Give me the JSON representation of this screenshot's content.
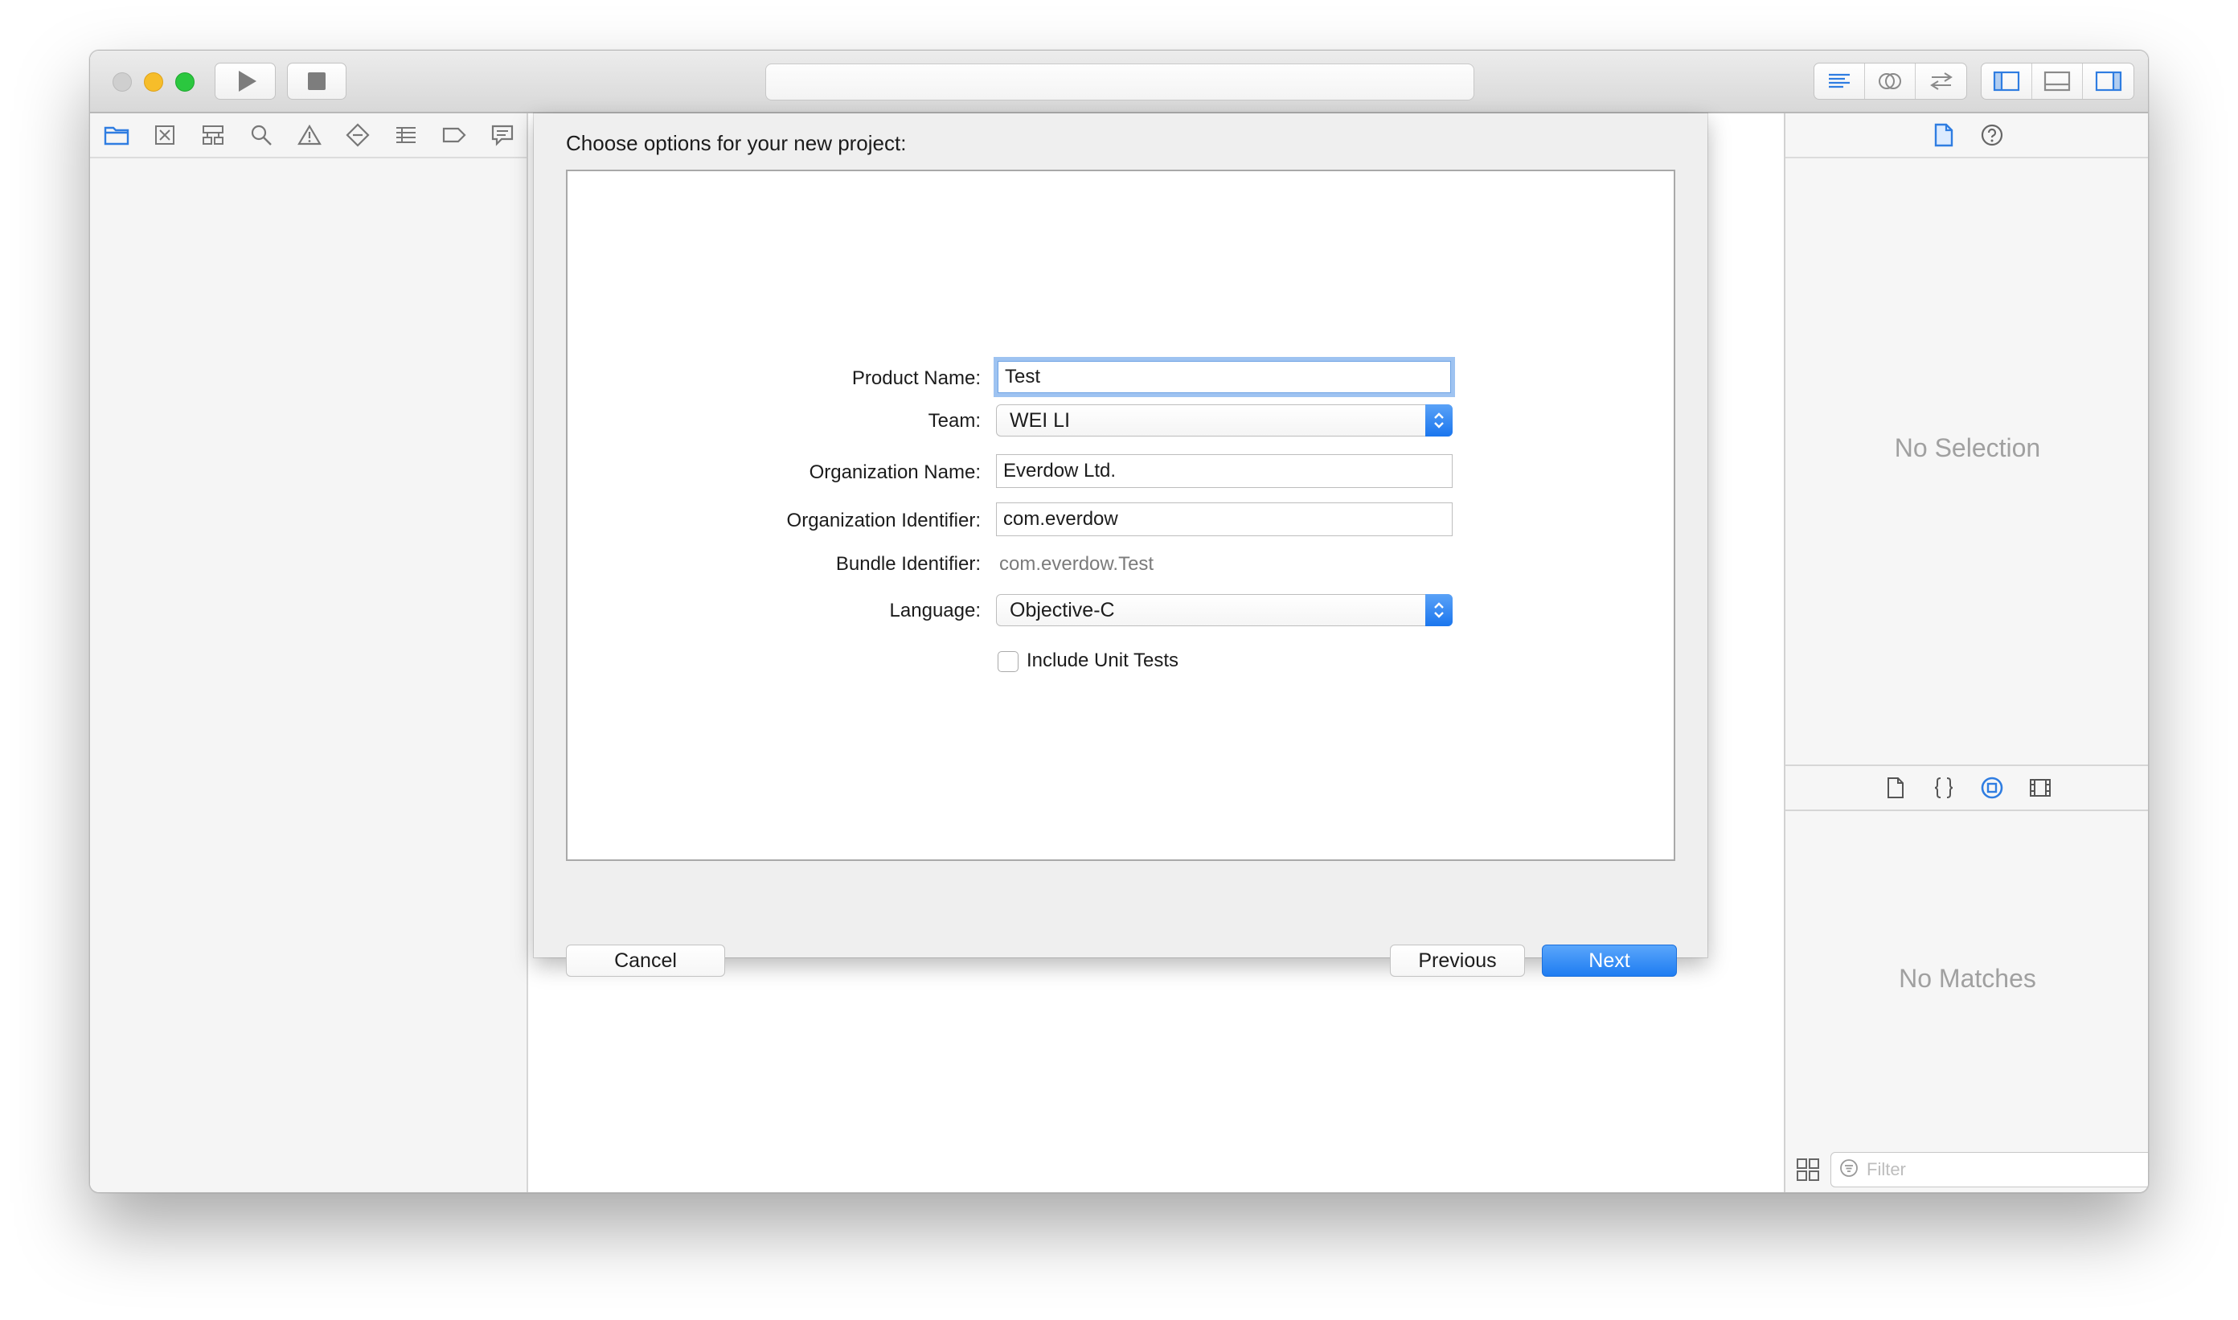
{
  "window": {
    "activity_text": "",
    "navigator_icons": [
      "folder-icon",
      "source-control-icon",
      "symbol-icon",
      "find-icon",
      "issue-icon",
      "test-icon",
      "debug-icon",
      "breakpoint-icon",
      "report-icon"
    ],
    "editor_mode_icons": [
      "standard-editor-icon",
      "assistant-editor-icon",
      "version-editor-icon"
    ],
    "view_toggle_icons": [
      "navigator-toggle-icon",
      "debug-area-toggle-icon",
      "utilities-toggle-icon"
    ]
  },
  "sheet": {
    "title": "Choose options for your new project:",
    "form": {
      "product_name_label": "Product Name:",
      "product_name_value": "Test",
      "team_label": "Team:",
      "team_value": "WEI LI",
      "organization_name_label": "Organization Name:",
      "organization_name_value": "Everdow Ltd.",
      "organization_identifier_label": "Organization Identifier:",
      "organization_identifier_value": "com.everdow",
      "bundle_identifier_label": "Bundle Identifier:",
      "bundle_identifier_value": "com.everdow.Test",
      "language_label": "Language:",
      "language_value": "Objective-C",
      "include_unit_tests_label": "Include Unit Tests",
      "include_unit_tests_checked": false
    },
    "buttons": {
      "cancel": "Cancel",
      "previous": "Previous",
      "next": "Next"
    }
  },
  "inspector": {
    "no_selection": "No Selection",
    "no_matches": "No Matches",
    "filter_placeholder": "Filter",
    "inspector_tabs": [
      "file-inspector-icon",
      "quick-help-icon"
    ],
    "library_tabs": [
      "file-template-icon",
      "code-snippet-icon",
      "object-library-icon",
      "media-library-icon"
    ]
  },
  "colors": {
    "accent": "#1e7cf1",
    "focus_ring": "#9ec3f1",
    "close_button": "#cfcfcf",
    "minimize_button": "#f6bd2a",
    "zoom_button": "#2bc73f"
  }
}
